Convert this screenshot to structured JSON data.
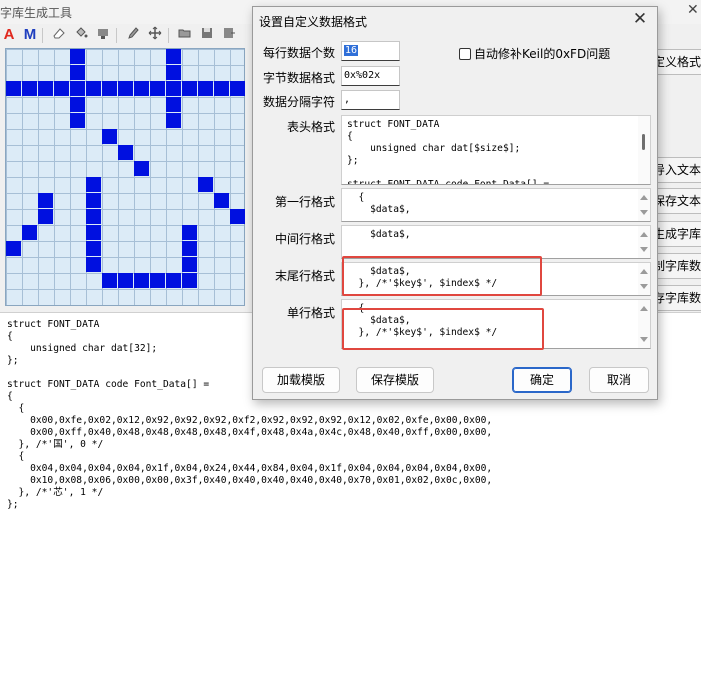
{
  "app": {
    "title": "字库生成工具",
    "toolbar": {
      "icons": [
        "font-a-icon",
        "font-m-icon",
        "eraser-icon",
        "fill-bucket-icon",
        "stamp-icon",
        "pencil-icon",
        "move-icon",
        "open-folder-icon",
        "save-icon",
        "export-icon"
      ],
      "label_a": "A",
      "label_m": "M"
    },
    "side_buttons": [
      "定义格式",
      "导入文本",
      "保存文本",
      "生成字库",
      "制字库数据",
      "存字库数据"
    ],
    "code_output": "struct FONT_DATA\n{\n    unsigned char dat[32];\n};\n\nstruct FONT_DATA code Font_Data[] =\n{\n  {\n    0x00,0xfe,0x02,0x12,0x92,0x92,0x92,0xf2,0x92,0x92,0x92,0x12,0x02,0xfe,0x00,0x00,\n    0x00,0xff,0x40,0x48,0x48,0x48,0x48,0x4f,0x48,0x4a,0x4c,0x48,0x40,0xff,0x00,0x00,\n  }, /*'国', 0 */\n  {\n    0x04,0x04,0x04,0x04,0x1f,0x04,0x24,0x44,0x84,0x04,0x1f,0x04,0x04,0x04,0x04,0x00,\n    0x10,0x08,0x06,0x00,0x00,0x3f,0x40,0x40,0x40,0x40,0x40,0x70,0x01,0x02,0x0c,0x00,\n  }, /*'芯', 1 */\n};",
    "grid_color": "#dcebf7",
    "pixel_color": "#0010e0"
  },
  "dialog": {
    "title": "设置自定义数据格式",
    "bytes_per_line_label": "每行数据个数",
    "bytes_per_line_value": "16",
    "byte_format_label": "字节数据格式",
    "byte_format_value": "0x%02x",
    "separator_label": "数据分隔字符",
    "separator_value": ",",
    "keil_fix_label": "自动修补Keil的0xFD问题",
    "header_label": "表头格式",
    "header_value": "struct FONT_DATA\n{\n    unsigned char dat[$size$];\n};\n\nstruct FONT_DATA code Font_Data[] =",
    "first_line_label": "第一行格式",
    "first_line_value": "  {\n    $data$,",
    "middle_line_label": "中间行格式",
    "middle_line_value": "    $data$,",
    "last_line_label": "末尾行格式",
    "last_line_value": "    $data$,\n  }, /*'$key$', $index$ */",
    "single_line_label": "单行格式",
    "single_line_value": "  {\n    $data$,\n  }, /*'$key$', $index$ */",
    "load_template": "加载模版",
    "save_template": "保存模版",
    "ok": "确定",
    "cancel": "取消",
    "highlight_color": "#e0473f"
  }
}
